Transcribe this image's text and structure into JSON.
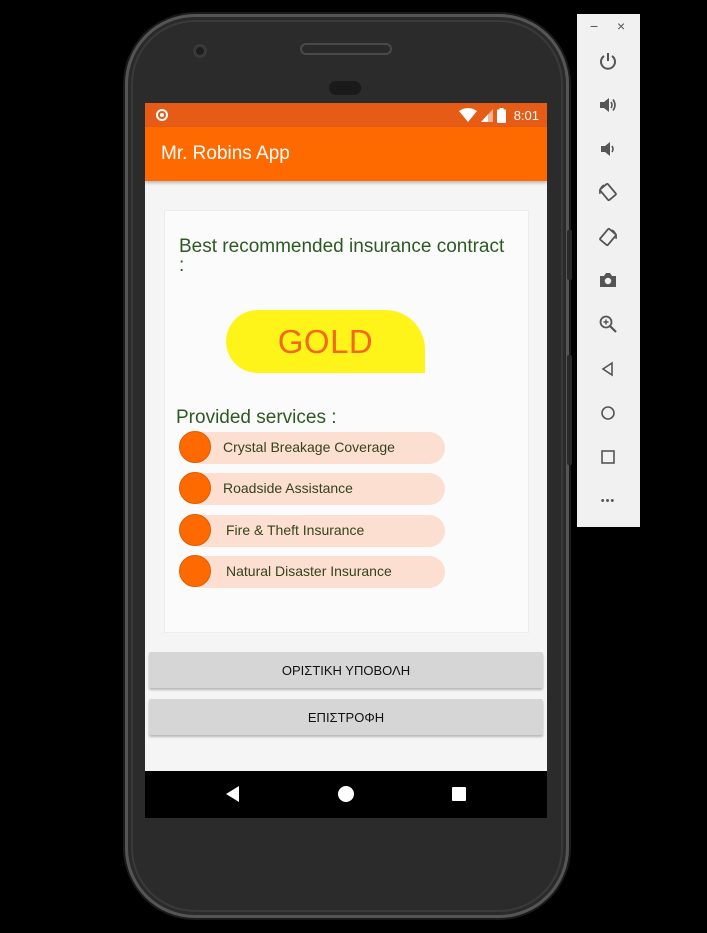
{
  "status_bar": {
    "time": "8:01"
  },
  "app_bar": {
    "title": "Mr. Robins App"
  },
  "recommendation": {
    "heading": "Best recommended insurance contract :",
    "plan": "GOLD",
    "services_title": "Provided services :",
    "services": [
      "Crystal Breakage Coverage",
      "Roadside Assistance",
      "Fire & Theft Insurance",
      "Natural Disaster Insurance"
    ]
  },
  "buttons": {
    "submit": "ΟΡΙΣΤΙΚΗ ΥΠΟΒΟΛΗ",
    "back": "ΕΠΙΣΤΡΟΦΗ"
  },
  "emulator_toolbar": {
    "minimize": "−",
    "close": "×",
    "more": "•••",
    "tools": [
      "power-icon",
      "volume-up-icon",
      "volume-down-icon",
      "rotate-left-icon",
      "rotate-right-icon",
      "camera-icon",
      "zoom-icon",
      "back-icon",
      "home-icon",
      "overview-icon",
      "more-icon"
    ]
  },
  "colors": {
    "status_bar": "#e65c17",
    "app_bar": "#ff6a00",
    "badge": "#fff41a",
    "badge_text": "#f06a1a",
    "service_pill": "#fcdfd0",
    "heading_text": "#2d5a23"
  }
}
